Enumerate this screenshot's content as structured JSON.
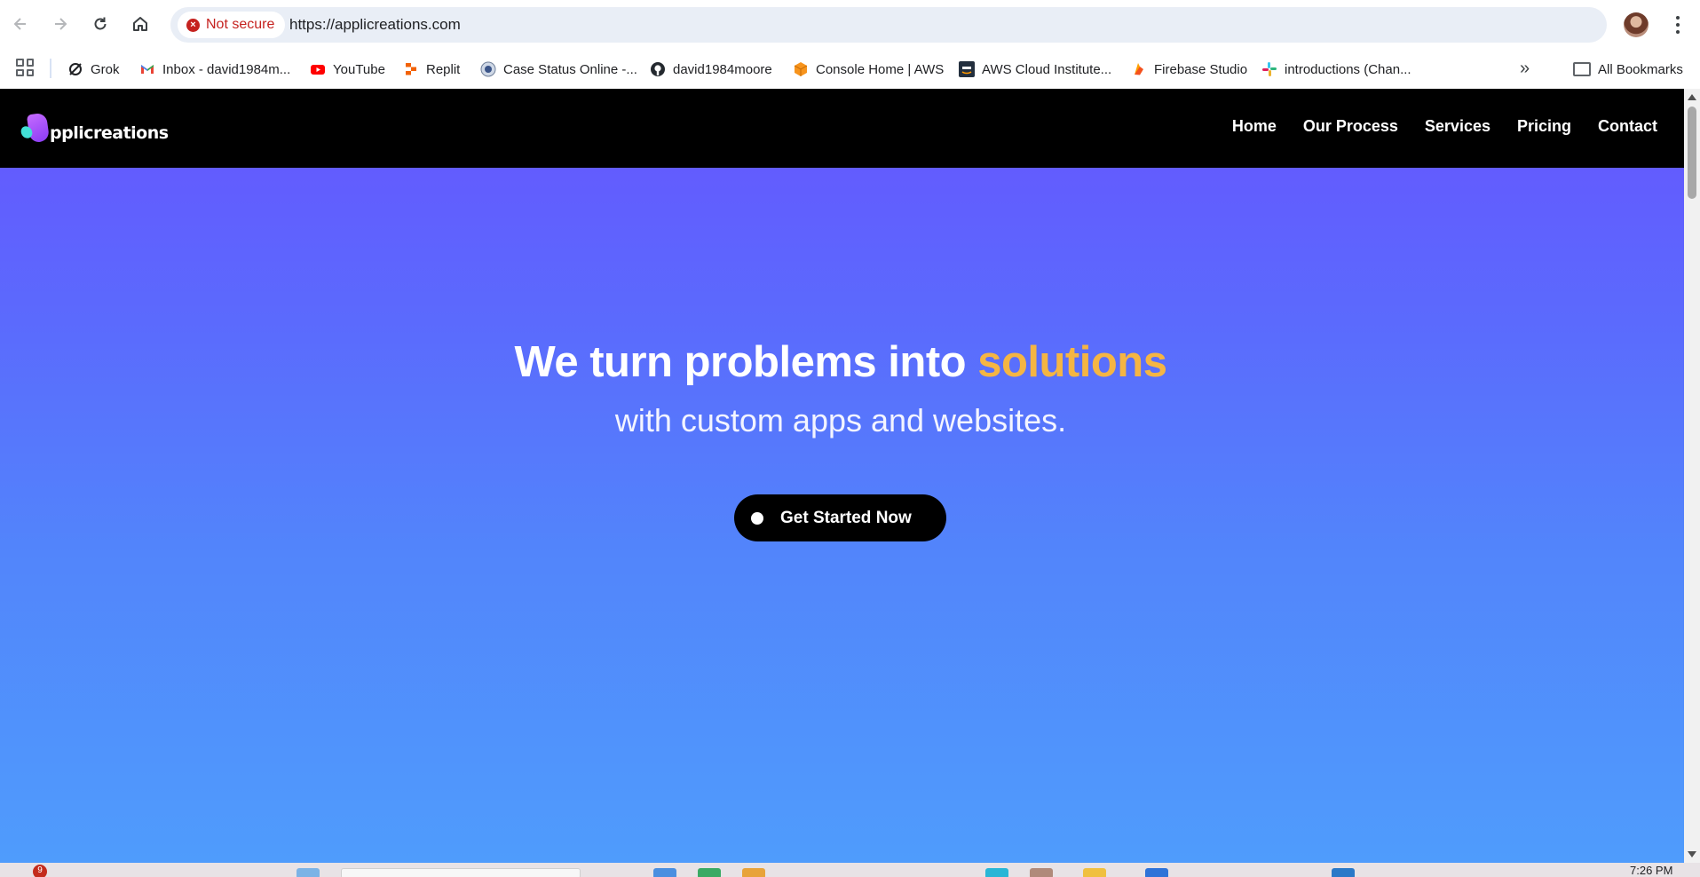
{
  "browser": {
    "security_label": "Not secure",
    "url": "https://applicreations.com",
    "bookmarks": [
      {
        "label": "Grok",
        "icon": "grok-icon"
      },
      {
        "label": "Inbox - david1984m...",
        "icon": "gmail-icon"
      },
      {
        "label": "YouTube",
        "icon": "youtube-icon"
      },
      {
        "label": "Replit",
        "icon": "replit-icon"
      },
      {
        "label": "Case Status Online -...",
        "icon": "uscis-icon"
      },
      {
        "label": "david1984moore",
        "icon": "github-icon"
      },
      {
        "label": "Console Home | AWS",
        "icon": "aws-cube-icon"
      },
      {
        "label": "AWS Cloud Institute...",
        "icon": "aws-icon"
      },
      {
        "label": "Firebase Studio",
        "icon": "firebase-icon"
      },
      {
        "label": "introductions (Chan...",
        "icon": "slack-icon"
      }
    ],
    "all_bookmarks_label": "All Bookmarks",
    "more_glyph": "»"
  },
  "site": {
    "logo_text": "pplicreations",
    "nav": [
      "Home",
      "Our Process",
      "Services",
      "Pricing",
      "Contact"
    ],
    "hero": {
      "title_main": "We turn problems into ",
      "title_accent": "solutions",
      "subtitle": "with custom apps and websites.",
      "cta_label": "Get Started Now"
    },
    "colors": {
      "header_bg": "#000000",
      "hero_gradient_top": "#6655ff",
      "hero_gradient_bottom": "#4f9cfc",
      "accent": "#f5b543"
    }
  },
  "taskbar": {
    "notification_count": "9",
    "clock": "7:26 PM"
  }
}
